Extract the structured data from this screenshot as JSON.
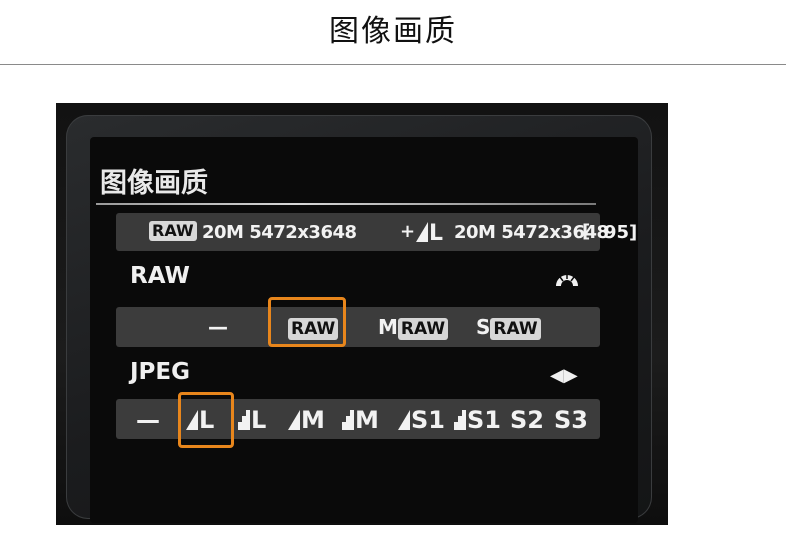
{
  "page": {
    "title": "图像画质"
  },
  "camera": {
    "menu_title": "图像画质",
    "info": {
      "raw_badge": "RAW",
      "raw_spec": "20M 5472x3648",
      "plus": "+",
      "jpeg_spec": "20M 5472x3648",
      "bracket": "[",
      "shots_remaining": "95]"
    },
    "raw_section": {
      "label": "RAW",
      "icon": "main-dial-icon",
      "options": [
        {
          "text": "—",
          "badge": ""
        },
        {
          "text": "",
          "badge": "RAW"
        },
        {
          "text": "M",
          "badge": "RAW"
        },
        {
          "text": "S",
          "badge": "RAW"
        }
      ],
      "selected_index": 1
    },
    "jpeg_section": {
      "label": "JPEG",
      "icon": "left-right-arrows-icon",
      "arrows": "◀▶",
      "options": [
        {
          "text": "—",
          "quality": ""
        },
        {
          "text": "L",
          "quality": "fine"
        },
        {
          "text": "L",
          "quality": "normal"
        },
        {
          "text": "M",
          "quality": "fine"
        },
        {
          "text": "M",
          "quality": "normal"
        },
        {
          "text": "S1",
          "quality": "fine"
        },
        {
          "text": "S1",
          "quality": "normal"
        },
        {
          "text": "S2",
          "quality": ""
        },
        {
          "text": "S3",
          "quality": ""
        }
      ],
      "selected_index": 1
    },
    "accent_color": "#e8861c"
  }
}
